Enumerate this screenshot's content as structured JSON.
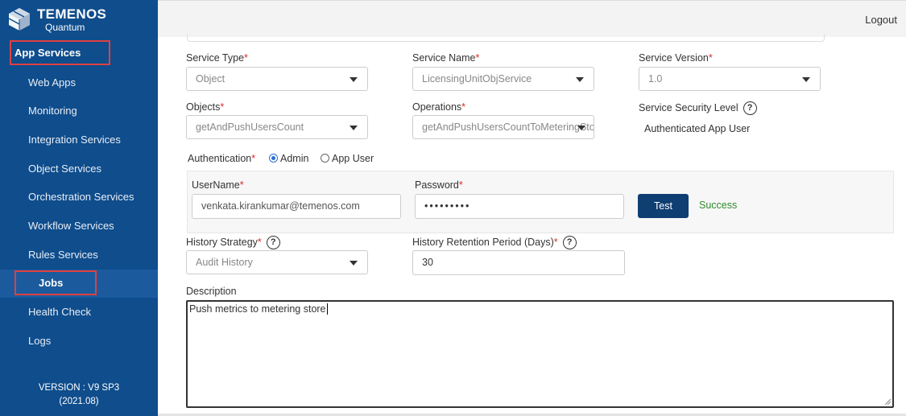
{
  "sidebar": {
    "brand": "TEMENOS",
    "brand_sub": "Quantum",
    "section": "App Services",
    "items": [
      {
        "label": "Web Apps"
      },
      {
        "label": "Monitoring"
      },
      {
        "label": "Integration Services"
      },
      {
        "label": "Object Services"
      },
      {
        "label": "Orchestration Services"
      },
      {
        "label": "Workflow Services"
      },
      {
        "label": "Rules Services"
      },
      {
        "label": "Jobs",
        "active": true
      },
      {
        "label": "Health Check"
      },
      {
        "label": "Logs"
      }
    ],
    "version_line1": "VERSION : V9 SP3",
    "version_line2": "(2021.08)"
  },
  "header": {
    "logout": "Logout"
  },
  "form": {
    "service_type": {
      "label": "Service Type",
      "value": "Object"
    },
    "service_name": {
      "label": "Service Name",
      "value": "LicensingUnitObjService"
    },
    "service_version": {
      "label": "Service Version",
      "value": "1.0"
    },
    "objects": {
      "label": "Objects",
      "value": "getAndPushUsersCount"
    },
    "operations": {
      "label": "Operations",
      "value": "getAndPushUsersCountToMeteringStor"
    },
    "security_level": {
      "label": "Service Security Level",
      "value": "Authenticated App User"
    },
    "authentication": {
      "label": "Authentication",
      "options": [
        "Admin",
        "App User"
      ],
      "selected": "Admin"
    },
    "username": {
      "label": "UserName",
      "value": "venkata.kirankumar@temenos.com"
    },
    "password": {
      "label": "Password",
      "value": "•••••••••"
    },
    "test_button": "Test",
    "test_status": "Success",
    "history_strategy": {
      "label": "History Strategy",
      "value": "Audit History"
    },
    "retention": {
      "label": "History Retention Period (Days)",
      "value": "30"
    },
    "description": {
      "label": "Description",
      "value": "Push metrics to metering store"
    }
  },
  "colors": {
    "sidebar": "#0f4d8c",
    "accent_button": "#0f3e73",
    "required": "#d62c2c",
    "success": "#2e8b2e",
    "highlight_box": "#e04040"
  },
  "icons": {
    "logo": "temenos-cube-logo",
    "help": "question-circle-icon",
    "dropdown": "caret-down-icon"
  }
}
